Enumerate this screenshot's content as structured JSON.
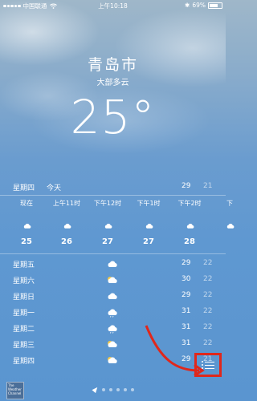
{
  "status_bar": {
    "carrier": "中国联通",
    "time": "上午10:18",
    "battery": "69%",
    "battery_level": 0.69
  },
  "location": {
    "city": "青岛市",
    "condition": "大部多云",
    "temperature": "25°"
  },
  "today": {
    "day": "星期四",
    "tag": "今天",
    "high": "29",
    "low": "21"
  },
  "hourly": [
    {
      "time": "现在",
      "icon": "cloud-icon",
      "temp": "25"
    },
    {
      "time": "上午11时",
      "icon": "cloud-icon",
      "temp": "26"
    },
    {
      "time": "下午12时",
      "icon": "cloud-icon",
      "temp": "27"
    },
    {
      "time": "下午1时",
      "icon": "cloud-icon",
      "temp": "27"
    },
    {
      "time": "下午2时",
      "icon": "cloud-icon",
      "temp": "28"
    },
    {
      "time": "下",
      "icon": "cloud-icon",
      "temp": ""
    }
  ],
  "daily": [
    {
      "day": "星期五",
      "icon": "cloud-icon",
      "high": "29",
      "low": "22"
    },
    {
      "day": "星期六",
      "icon": "partly-sunny-icon",
      "high": "30",
      "low": "22"
    },
    {
      "day": "星期日",
      "icon": "cloud-icon",
      "high": "29",
      "low": "22"
    },
    {
      "day": "星期一",
      "icon": "rain-cloud-icon",
      "high": "31",
      "low": "22"
    },
    {
      "day": "星期二",
      "icon": "rain-cloud-icon",
      "high": "31",
      "low": "22"
    },
    {
      "day": "星期三",
      "icon": "partly-sunny-icon",
      "high": "31",
      "low": "22"
    },
    {
      "day": "星期四",
      "icon": "partly-sunny-icon",
      "high": "29",
      "low": "21"
    }
  ],
  "footer": {
    "logo_text": "The Weather Channel",
    "page_count": 6,
    "current_page": 0
  },
  "colors": {
    "highlight_box": "#e0271b",
    "sky_top": "#9fb7c9",
    "sky_bottom": "#5a95d0"
  }
}
